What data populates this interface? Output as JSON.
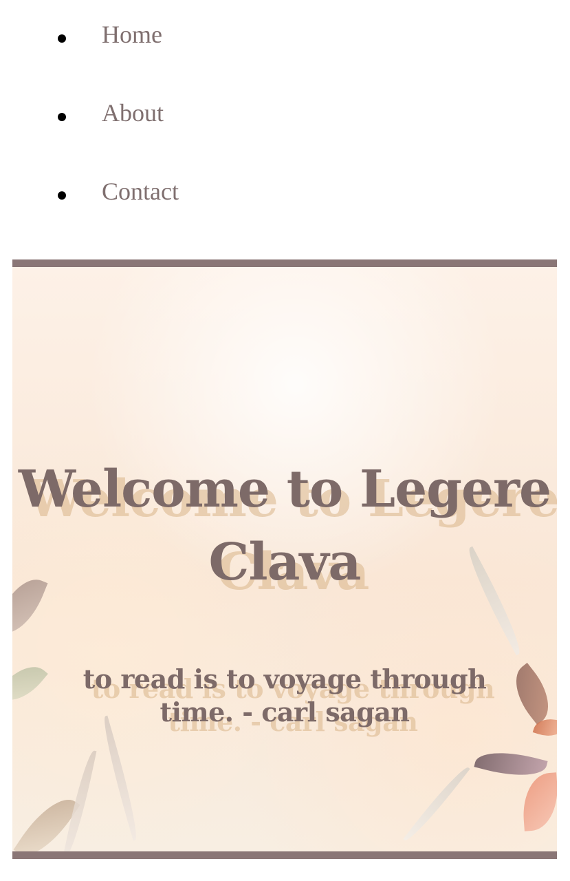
{
  "nav": {
    "items": [
      {
        "label": "Home"
      },
      {
        "label": "About"
      },
      {
        "label": "Contact"
      }
    ]
  },
  "hero": {
    "title": "Welcome to Legere Clava",
    "quote": "to read is to voyage through time. - carl sagan"
  },
  "colors": {
    "text_primary": "#7d6a68",
    "border": "#8a7676",
    "background": "#fdf1e7",
    "shadow": "#d8b489"
  }
}
